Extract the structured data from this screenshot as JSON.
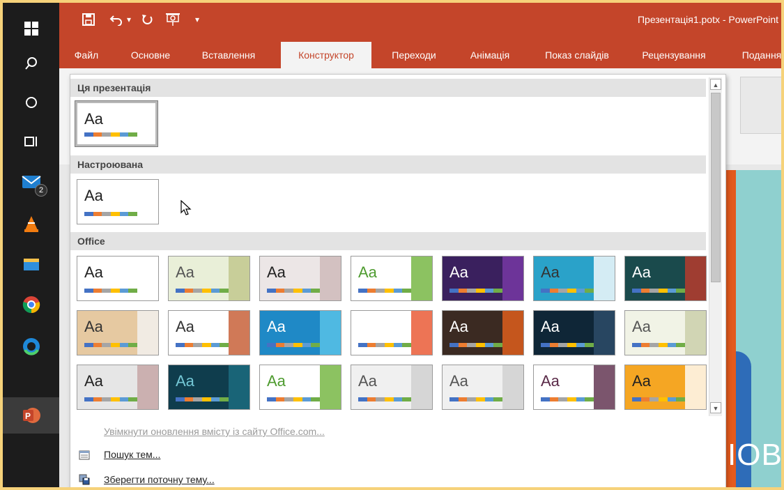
{
  "window": {
    "title": "Презентація1.potx  -  PowerPoint",
    "tabs": [
      "Файл",
      "Основне",
      "Вставлення",
      "Конструктор",
      "Переходи",
      "Анімація",
      "Показ слайдів",
      "Рецензування",
      "Подання"
    ],
    "active_tab": "Конструктор"
  },
  "taskbar": {
    "icons": [
      "windows-start-icon",
      "search-icon",
      "cortana-icon",
      "task-view-icon",
      "mail-icon",
      "vlc-icon",
      "file-explorer-icon",
      "chrome-icon",
      "edge-icon",
      "powerpoint-icon"
    ],
    "mail_badge": "2"
  },
  "quick_access": [
    "save-icon",
    "undo-icon",
    "dropdown-icon",
    "redo-icon",
    "presentation-icon",
    "customize-icon"
  ],
  "gallery": {
    "sections": [
      "Ця презентація",
      "Настроювана",
      "Office"
    ],
    "thumb_label": "Aa",
    "themes": [
      {
        "bg": "#ffffff",
        "fg": "#222222",
        "accent": "#ffffff"
      },
      {
        "bg": "#e9efd8",
        "fg": "#555555",
        "accent": "#bfc68a"
      },
      {
        "bg": "#ece6e6",
        "fg": "#222222",
        "accent": "#cdb8b8"
      },
      {
        "bg": "#ffffff",
        "fg": "#4e9b2f",
        "accent": "#6fb33a"
      },
      {
        "bg": "#3a205e",
        "fg": "#ffffff",
        "accent": "#7a3aa8"
      },
      {
        "bg": "#2aa2c9",
        "fg": "#333333",
        "accent": "#ffffff"
      },
      {
        "bg": "#1a4a4c",
        "fg": "#ffffff",
        "accent": "#c1392b"
      },
      {
        "bg": "#e6c9a1",
        "fg": "#333333",
        "accent": "#f4f4f4"
      },
      {
        "bg": "#ffffff",
        "fg": "#333333",
        "accent": "#c4572d"
      },
      {
        "bg": "#1f89c6",
        "fg": "#ffffff",
        "accent": "#5bc6e8"
      },
      {
        "bg": "#ffffff",
        "fg": "#ffffff",
        "accent": "#e8512a"
      },
      {
        "bg": "#3b2a22",
        "fg": "#ffffff",
        "accent": "#e8621d"
      },
      {
        "bg": "#0f2637",
        "fg": "#ffffff",
        "accent": "#2e4f6b"
      },
      {
        "bg": "#f1f3e6",
        "fg": "#555555",
        "accent": "#c9cda8"
      },
      {
        "bg": "#e6e6e6",
        "fg": "#222222",
        "accent": "#c4a3a3"
      },
      {
        "bg": "#0f3d4d",
        "fg": "#74c8d6",
        "accent": "#1b6e82"
      },
      {
        "bg": "#ffffff",
        "fg": "#4e9b2f",
        "accent": "#6fb33a"
      },
      {
        "bg": "#f0f0f0",
        "fg": "#555555",
        "accent": "#cfcfcf"
      },
      {
        "bg": "#f0f0f0",
        "fg": "#555555",
        "accent": "#cfcfcf"
      },
      {
        "bg": "#ffffff",
        "fg": "#5a2a48",
        "accent": "#5a2a48"
      },
      {
        "bg": "#f5a623",
        "fg": "#222222",
        "accent": "#ffffff"
      }
    ],
    "commands": [
      {
        "label": "Увімкнути оновлення вмісту із сайту Office.com...",
        "enabled": false
      },
      {
        "label": "Пошук тем...",
        "enabled": true
      },
      {
        "label": "Зберегти поточну тему...",
        "enabled": true
      }
    ]
  },
  "slide": {
    "visible_text": "ІОВ"
  },
  "colors": {
    "ribbon": "#c4452a",
    "taskbar": "#1c1c1c"
  }
}
